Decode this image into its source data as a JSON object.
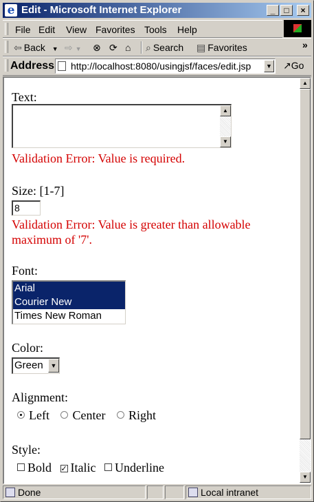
{
  "window": {
    "title": "Edit - Microsoft Internet Explorer",
    "minimize": "_",
    "maximize": "□",
    "close": "×"
  },
  "menubar": {
    "items": [
      {
        "label": "File",
        "accel": "F"
      },
      {
        "label": "Edit",
        "accel": "E"
      },
      {
        "label": "View",
        "accel": "V"
      },
      {
        "label": "Favorites",
        "accel": "a"
      },
      {
        "label": "Tools",
        "accel": "T"
      },
      {
        "label": "Help",
        "accel": "H"
      }
    ]
  },
  "toolbar": {
    "back": "Back",
    "search": "Search",
    "favorites": "Favorites",
    "more": "»"
  },
  "address": {
    "label": "Address",
    "url": "http://localhost:8080/usingjsf/faces/edit.jsp",
    "go": "Go"
  },
  "form": {
    "text_label": "Text:",
    "text_value": "",
    "text_error": "Validation Error: Value is required.",
    "size_label": "Size: [1-7]",
    "size_value": "8",
    "size_error_line1": "Validation Error: Value is greater than allowable",
    "size_error_line2": "maximum of '7'.",
    "font_label": "Font:",
    "font_options": [
      {
        "label": "Arial",
        "selected": true
      },
      {
        "label": "Courier New",
        "selected": true
      },
      {
        "label": "Times New Roman",
        "selected": false
      }
    ],
    "color_label": "Color:",
    "color_value": "Green",
    "alignment_label": "Alignment:",
    "alignment_options": [
      {
        "label": "Left",
        "checked": true
      },
      {
        "label": "Center",
        "checked": false
      },
      {
        "label": "Right",
        "checked": false
      }
    ],
    "style_label": "Style:",
    "style_options": [
      {
        "label": "Bold",
        "checked": false
      },
      {
        "label": "Italic",
        "checked": true
      },
      {
        "label": "Underline",
        "checked": false
      }
    ]
  },
  "statusbar": {
    "status": "Done",
    "zone": "Local intranet"
  },
  "colors": {
    "error": "#d40000",
    "selection": "#0a246a",
    "titlebar": "#0a246a"
  }
}
